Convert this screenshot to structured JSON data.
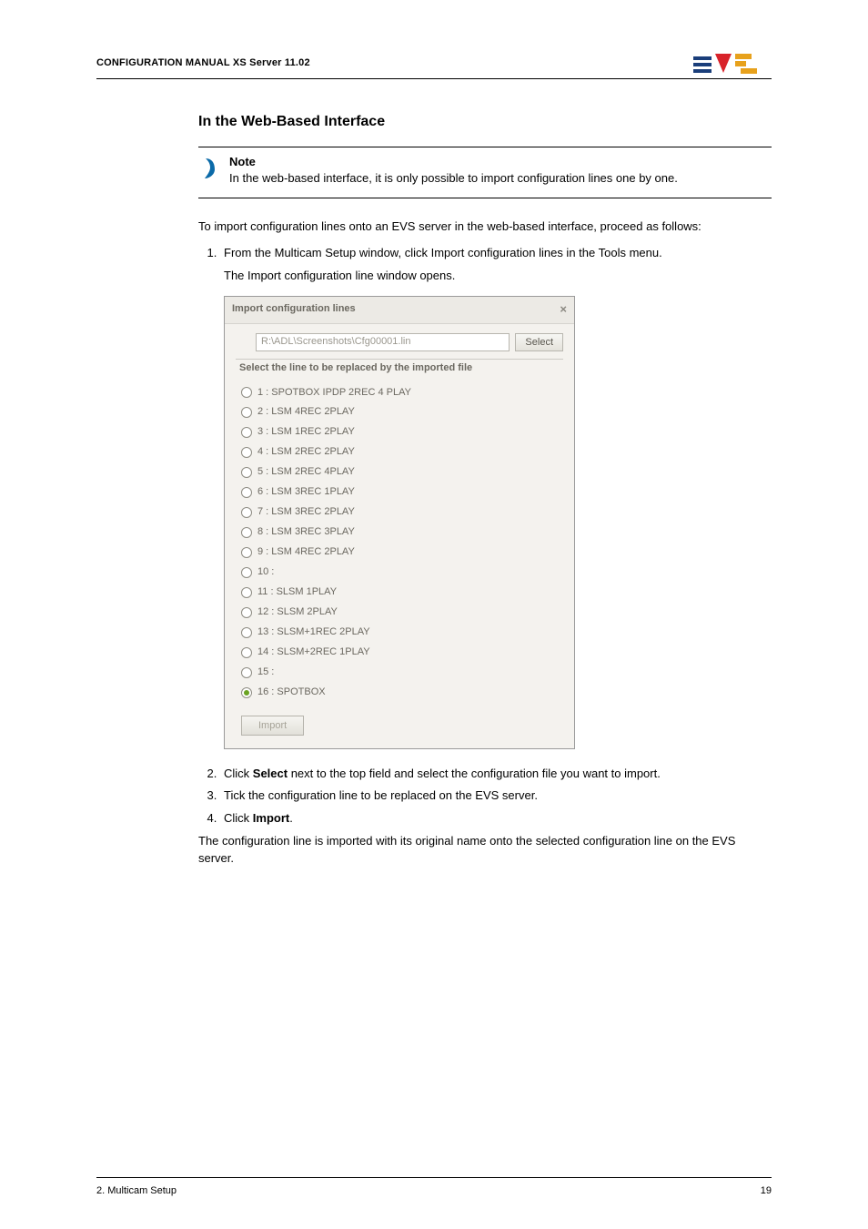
{
  "header": {
    "left": "CONFIGURATION MANUAL   XS Server 11.02"
  },
  "section": {
    "title": "In the Web-Based Interface",
    "note_title": "Note",
    "note_body": "In the web-based interface, it is only possible to import configuration lines one by one.",
    "intro": "To import configuration lines onto an EVS server in the web-based interface, proceed as follows:",
    "step1": "From the Multicam Setup window, click Import configuration lines in the Tools menu.",
    "step1_sub": "The Import configuration line window opens.",
    "step2_a": "Click ",
    "step2_b": "Select",
    "step2_c": " next to the top field and select the configuration file you want to import.",
    "step3": "Tick the configuration line to be replaced on the EVS server.",
    "step4_a": "Click ",
    "step4_b": "Import",
    "step4_c": ".",
    "outro": "The configuration line is imported with its original name onto the selected configuration line on the EVS server."
  },
  "dialog": {
    "title": "Import configuration lines",
    "close": "×",
    "file_path": "R:\\ADL\\Screenshots\\Cfg00001.lin",
    "select_label": "Select",
    "fieldset_label": "Select the line to be replaced by the imported file",
    "lines": [
      {
        "label": "1 : SPOTBOX IPDP 2REC 4 PLAY",
        "selected": false
      },
      {
        "label": "2 : LSM 4REC 2PLAY",
        "selected": false
      },
      {
        "label": "3 : LSM 1REC 2PLAY",
        "selected": false
      },
      {
        "label": "4 : LSM 2REC 2PLAY",
        "selected": false
      },
      {
        "label": "5 : LSM 2REC 4PLAY",
        "selected": false
      },
      {
        "label": "6 : LSM 3REC 1PLAY",
        "selected": false
      },
      {
        "label": "7 : LSM 3REC 2PLAY",
        "selected": false
      },
      {
        "label": "8 : LSM 3REC 3PLAY",
        "selected": false
      },
      {
        "label": "9 : LSM 4REC 2PLAY",
        "selected": false
      },
      {
        "label": "10 :",
        "selected": false
      },
      {
        "label": "11 : SLSM 1PLAY",
        "selected": false
      },
      {
        "label": "12 : SLSM 2PLAY",
        "selected": false
      },
      {
        "label": "13 : SLSM+1REC 2PLAY",
        "selected": false
      },
      {
        "label": "14 : SLSM+2REC 1PLAY",
        "selected": false
      },
      {
        "label": "15 :",
        "selected": false
      },
      {
        "label": "16 : SPOTBOX",
        "selected": true
      }
    ],
    "import_label": "Import"
  },
  "footer": {
    "left": "2. Multicam Setup",
    "right": "19"
  }
}
